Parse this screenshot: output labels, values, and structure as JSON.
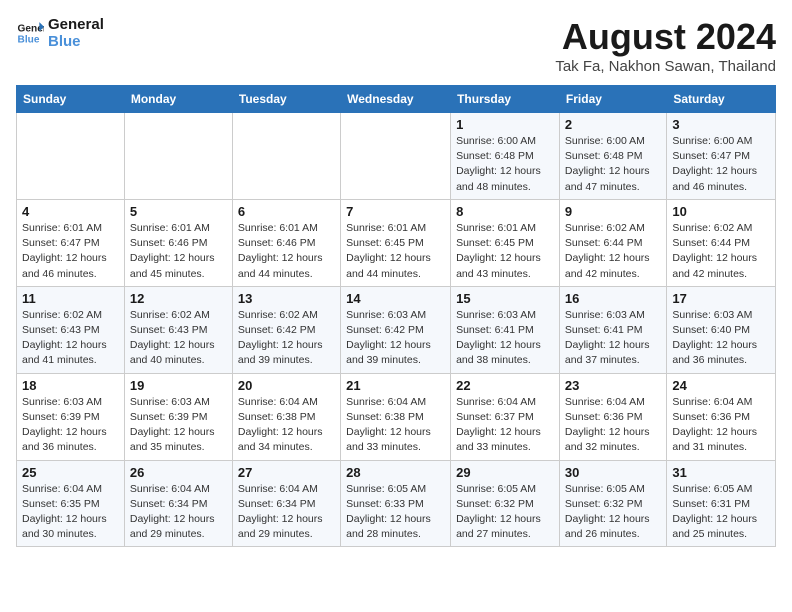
{
  "logo": {
    "line1": "General",
    "line2": "Blue"
  },
  "title": "August 2024",
  "subtitle": "Tak Fa, Nakhon Sawan, Thailand",
  "days_of_week": [
    "Sunday",
    "Monday",
    "Tuesday",
    "Wednesday",
    "Thursday",
    "Friday",
    "Saturday"
  ],
  "weeks": [
    [
      {
        "day": "",
        "info": ""
      },
      {
        "day": "",
        "info": ""
      },
      {
        "day": "",
        "info": ""
      },
      {
        "day": "",
        "info": ""
      },
      {
        "day": "1",
        "info": "Sunrise: 6:00 AM\nSunset: 6:48 PM\nDaylight: 12 hours\nand 48 minutes."
      },
      {
        "day": "2",
        "info": "Sunrise: 6:00 AM\nSunset: 6:48 PM\nDaylight: 12 hours\nand 47 minutes."
      },
      {
        "day": "3",
        "info": "Sunrise: 6:00 AM\nSunset: 6:47 PM\nDaylight: 12 hours\nand 46 minutes."
      }
    ],
    [
      {
        "day": "4",
        "info": "Sunrise: 6:01 AM\nSunset: 6:47 PM\nDaylight: 12 hours\nand 46 minutes."
      },
      {
        "day": "5",
        "info": "Sunrise: 6:01 AM\nSunset: 6:46 PM\nDaylight: 12 hours\nand 45 minutes."
      },
      {
        "day": "6",
        "info": "Sunrise: 6:01 AM\nSunset: 6:46 PM\nDaylight: 12 hours\nand 44 minutes."
      },
      {
        "day": "7",
        "info": "Sunrise: 6:01 AM\nSunset: 6:45 PM\nDaylight: 12 hours\nand 44 minutes."
      },
      {
        "day": "8",
        "info": "Sunrise: 6:01 AM\nSunset: 6:45 PM\nDaylight: 12 hours\nand 43 minutes."
      },
      {
        "day": "9",
        "info": "Sunrise: 6:02 AM\nSunset: 6:44 PM\nDaylight: 12 hours\nand 42 minutes."
      },
      {
        "day": "10",
        "info": "Sunrise: 6:02 AM\nSunset: 6:44 PM\nDaylight: 12 hours\nand 42 minutes."
      }
    ],
    [
      {
        "day": "11",
        "info": "Sunrise: 6:02 AM\nSunset: 6:43 PM\nDaylight: 12 hours\nand 41 minutes."
      },
      {
        "day": "12",
        "info": "Sunrise: 6:02 AM\nSunset: 6:43 PM\nDaylight: 12 hours\nand 40 minutes."
      },
      {
        "day": "13",
        "info": "Sunrise: 6:02 AM\nSunset: 6:42 PM\nDaylight: 12 hours\nand 39 minutes."
      },
      {
        "day": "14",
        "info": "Sunrise: 6:03 AM\nSunset: 6:42 PM\nDaylight: 12 hours\nand 39 minutes."
      },
      {
        "day": "15",
        "info": "Sunrise: 6:03 AM\nSunset: 6:41 PM\nDaylight: 12 hours\nand 38 minutes."
      },
      {
        "day": "16",
        "info": "Sunrise: 6:03 AM\nSunset: 6:41 PM\nDaylight: 12 hours\nand 37 minutes."
      },
      {
        "day": "17",
        "info": "Sunrise: 6:03 AM\nSunset: 6:40 PM\nDaylight: 12 hours\nand 36 minutes."
      }
    ],
    [
      {
        "day": "18",
        "info": "Sunrise: 6:03 AM\nSunset: 6:39 PM\nDaylight: 12 hours\nand 36 minutes."
      },
      {
        "day": "19",
        "info": "Sunrise: 6:03 AM\nSunset: 6:39 PM\nDaylight: 12 hours\nand 35 minutes."
      },
      {
        "day": "20",
        "info": "Sunrise: 6:04 AM\nSunset: 6:38 PM\nDaylight: 12 hours\nand 34 minutes."
      },
      {
        "day": "21",
        "info": "Sunrise: 6:04 AM\nSunset: 6:38 PM\nDaylight: 12 hours\nand 33 minutes."
      },
      {
        "day": "22",
        "info": "Sunrise: 6:04 AM\nSunset: 6:37 PM\nDaylight: 12 hours\nand 33 minutes."
      },
      {
        "day": "23",
        "info": "Sunrise: 6:04 AM\nSunset: 6:36 PM\nDaylight: 12 hours\nand 32 minutes."
      },
      {
        "day": "24",
        "info": "Sunrise: 6:04 AM\nSunset: 6:36 PM\nDaylight: 12 hours\nand 31 minutes."
      }
    ],
    [
      {
        "day": "25",
        "info": "Sunrise: 6:04 AM\nSunset: 6:35 PM\nDaylight: 12 hours\nand 30 minutes."
      },
      {
        "day": "26",
        "info": "Sunrise: 6:04 AM\nSunset: 6:34 PM\nDaylight: 12 hours\nand 29 minutes."
      },
      {
        "day": "27",
        "info": "Sunrise: 6:04 AM\nSunset: 6:34 PM\nDaylight: 12 hours\nand 29 minutes."
      },
      {
        "day": "28",
        "info": "Sunrise: 6:05 AM\nSunset: 6:33 PM\nDaylight: 12 hours\nand 28 minutes."
      },
      {
        "day": "29",
        "info": "Sunrise: 6:05 AM\nSunset: 6:32 PM\nDaylight: 12 hours\nand 27 minutes."
      },
      {
        "day": "30",
        "info": "Sunrise: 6:05 AM\nSunset: 6:32 PM\nDaylight: 12 hours\nand 26 minutes."
      },
      {
        "day": "31",
        "info": "Sunrise: 6:05 AM\nSunset: 6:31 PM\nDaylight: 12 hours\nand 25 minutes."
      }
    ]
  ]
}
